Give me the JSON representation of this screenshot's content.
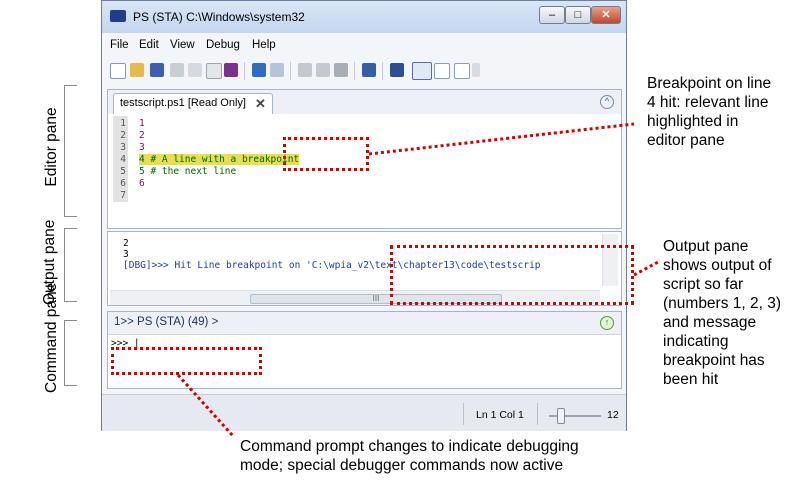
{
  "window": {
    "title": "PS (STA)  C:\\Windows\\system32",
    "caption_buttons": [
      "minimize",
      "maximize",
      "close"
    ]
  },
  "menu": [
    "File",
    "Edit",
    "View",
    "Debug",
    "Help"
  ],
  "editor": {
    "tab_label": "testscript.ps1 [Read Only]",
    "tab_close": "✕",
    "lines": [
      {
        "num": "1",
        "text": "1",
        "type": "code"
      },
      {
        "num": "2",
        "text": "2",
        "type": "code"
      },
      {
        "num": "3",
        "text": "3",
        "type": "code"
      },
      {
        "num": "4",
        "text": "4 # A line with a breakpoint",
        "type": "hit"
      },
      {
        "num": "5",
        "text": "5 # the next line",
        "type": "code"
      },
      {
        "num": "6",
        "text": "6",
        "type": "code"
      },
      {
        "num": "7",
        "text": "",
        "type": "code"
      }
    ]
  },
  "output": {
    "lines": [
      "2",
      "3",
      "[DBG]>>> Hit Line breakpoint on 'C:\\wpia_v2\\text\\chapter13\\code\\testscrip"
    ],
    "scroll_thumb": "III"
  },
  "command": {
    "title": "1>> PS (STA) (49) >",
    "prompt": ">>> |"
  },
  "statusbar": {
    "position": "Ln 1  Col 1",
    "zoom": "12"
  },
  "side_labels": {
    "editor": "Editor pane",
    "output": "Output pane",
    "command": "Command pane"
  },
  "annotations": {
    "breakpoint": [
      "Breakpoint on line",
      "4 hit: relevant line",
      "highlighted in",
      "editor pane"
    ],
    "output": [
      "Output pane",
      "shows output of",
      "script so far",
      "(numbers 1, 2, 3)",
      "and message",
      "indicating",
      "breakpoint has",
      "been hit"
    ],
    "command": [
      "Command prompt changes to indicate debugging",
      "mode; special debugger commands now active"
    ]
  },
  "colors": {
    "highlight": "#e8e04a",
    "callout": "#d40000",
    "titlebar": "#c3d6ee"
  }
}
